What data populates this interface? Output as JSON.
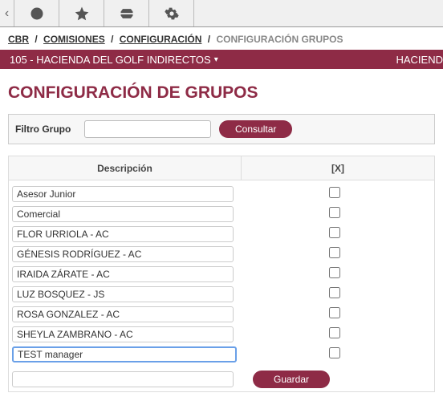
{
  "nav": {
    "back_icon": "‹"
  },
  "breadcrumb": {
    "items": [
      {
        "label": "CBR",
        "link": true
      },
      {
        "label": "COMISIONES",
        "link": true
      },
      {
        "label": "CONFIGURACIÓN",
        "link": true
      },
      {
        "label": "CONFIGURACIÓN GRUPOS",
        "link": false
      }
    ],
    "sep": "/"
  },
  "project": {
    "main": "105 - HACIENDA DEL GOLF INDIRECTOS",
    "caret": "▾",
    "right": "HACIEND"
  },
  "page": {
    "title": "CONFIGURACIÓN DE GRUPOS"
  },
  "filter": {
    "label": "Filtro Grupo",
    "value": "",
    "consult_label": "Consultar"
  },
  "table": {
    "header_desc": "Descripción",
    "header_x": "[X]",
    "rows": [
      {
        "desc": "Asesor Junior",
        "checked": false,
        "focused": false
      },
      {
        "desc": "Comercial",
        "checked": false,
        "focused": false
      },
      {
        "desc": "FLOR URRIOLA - AC",
        "checked": false,
        "focused": false
      },
      {
        "desc": "GÉNESIS RODRÍGUEZ - AC",
        "checked": false,
        "focused": false
      },
      {
        "desc": "IRAIDA ZÁRATE - AC",
        "checked": false,
        "focused": false
      },
      {
        "desc": "LUZ BOSQUEZ - JS",
        "checked": false,
        "focused": false
      },
      {
        "desc": "ROSA GONZALEZ - AC",
        "checked": false,
        "focused": false
      },
      {
        "desc": "SHEYLA ZAMBRANO - AC",
        "checked": false,
        "focused": false
      },
      {
        "desc": "TEST manager",
        "checked": false,
        "focused": true
      }
    ],
    "new_row_value": "",
    "save_label": "Guardar"
  }
}
